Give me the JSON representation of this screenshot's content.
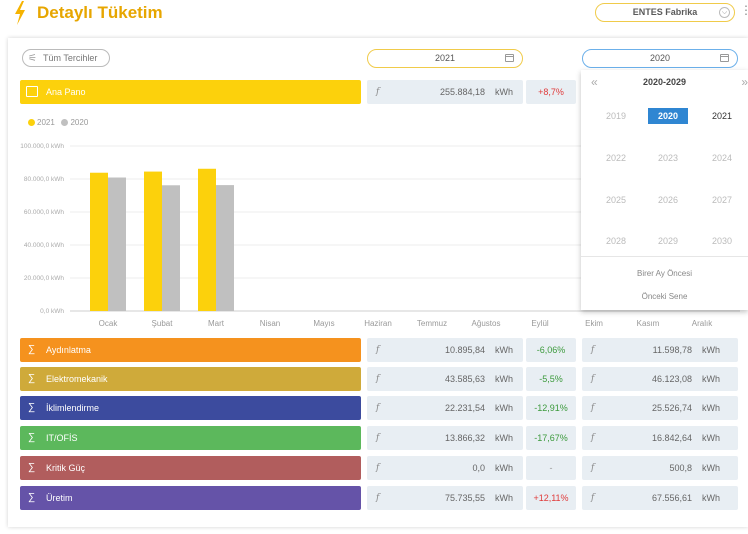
{
  "header": {
    "title": "Detaylı Tüketim",
    "factory_select": "ENTES Fabrika",
    "menu_glyph": "⋮",
    "accent_color": "#e7a600"
  },
  "toolbar": {
    "preferences_label": "Tüm Tercihler",
    "preferences_icon": "sliders-icon",
    "date_primary": "2021",
    "date_compare": "2020"
  },
  "main_row": {
    "label": "Ana Pano",
    "icon": "monitor-icon",
    "color": "#fcd10c",
    "value": "255.884,18",
    "unit": "kWh",
    "change": "+8,7%"
  },
  "chart_data": {
    "type": "bar",
    "categories": [
      "Ocak",
      "Şubat",
      "Mart",
      "Nisan",
      "Mayıs",
      "Haziran",
      "Temmuz",
      "Ağustos",
      "Eylül",
      "Ekim",
      "Kasım",
      "Aralık"
    ],
    "series": [
      {
        "name": "2021",
        "color": "#fcd10c",
        "values": [
          83800,
          84500,
          86200,
          null,
          null,
          null,
          null,
          null,
          null,
          null,
          null,
          null
        ]
      },
      {
        "name": "2020",
        "color": "#c0c0c0",
        "values": [
          80900,
          76200,
          76300,
          null,
          null,
          null,
          null,
          null,
          null,
          null,
          null,
          null
        ]
      }
    ],
    "y_ticks": [
      "0,0 kWh",
      "20.000,0 kWh",
      "40.000,0 kWh",
      "60.000,0 kWh",
      "80.000,0 kWh",
      "100.000,0 kWh"
    ],
    "ylim": [
      0,
      100000
    ],
    "legend_position": "top-left",
    "grid": true
  },
  "date_picker": {
    "prev_glyph": "«",
    "next_glyph": "»",
    "range_label": "2020-2029",
    "years": [
      "2019",
      "2020",
      "2021",
      "2022",
      "2023",
      "2024",
      "2025",
      "2026",
      "2027",
      "2028",
      "2029",
      "2030"
    ],
    "selected_year": "2020",
    "shortcut_month": "Birer Ay Öncesi",
    "shortcut_year": "Önceki Sene"
  },
  "categories": [
    {
      "label": "Aydınlatma",
      "color": "#f5921e",
      "value_2021": "10.895,84",
      "change": "-6,06%",
      "change_type": "neg",
      "value_2020": "11.598,78",
      "unit": "kWh"
    },
    {
      "label": "Elektromekanik",
      "color": "#cfaa3a",
      "value_2021": "43.585,63",
      "change": "-5,5%",
      "change_type": "neg",
      "value_2020": "46.123,08",
      "unit": "kWh"
    },
    {
      "label": "İklimlendirme",
      "color": "#3c4b9e",
      "value_2021": "22.231,54",
      "change": "-12,91%",
      "change_type": "neg",
      "value_2020": "25.526,74",
      "unit": "kWh"
    },
    {
      "label": "IT/OFİS",
      "color": "#5cb85c",
      "value_2021": "13.866,32",
      "change": "-17,67%",
      "change_type": "neg",
      "value_2020": "16.842,64",
      "unit": "kWh"
    },
    {
      "label": "Kritik Güç",
      "color": "#b15d5d",
      "value_2021": "0,0",
      "change": "-",
      "change_type": "none",
      "value_2020": "500,8",
      "unit": "kWh"
    },
    {
      "label": "Üretim",
      "color": "#6553a8",
      "value_2021": "75.735,55",
      "change": "+12,11%",
      "change_type": "pos",
      "value_2020": "67.556,61",
      "unit": "kWh"
    }
  ],
  "glyphs": {
    "sum": "∑",
    "energy": "f",
    "chevron_down": "⌵"
  }
}
